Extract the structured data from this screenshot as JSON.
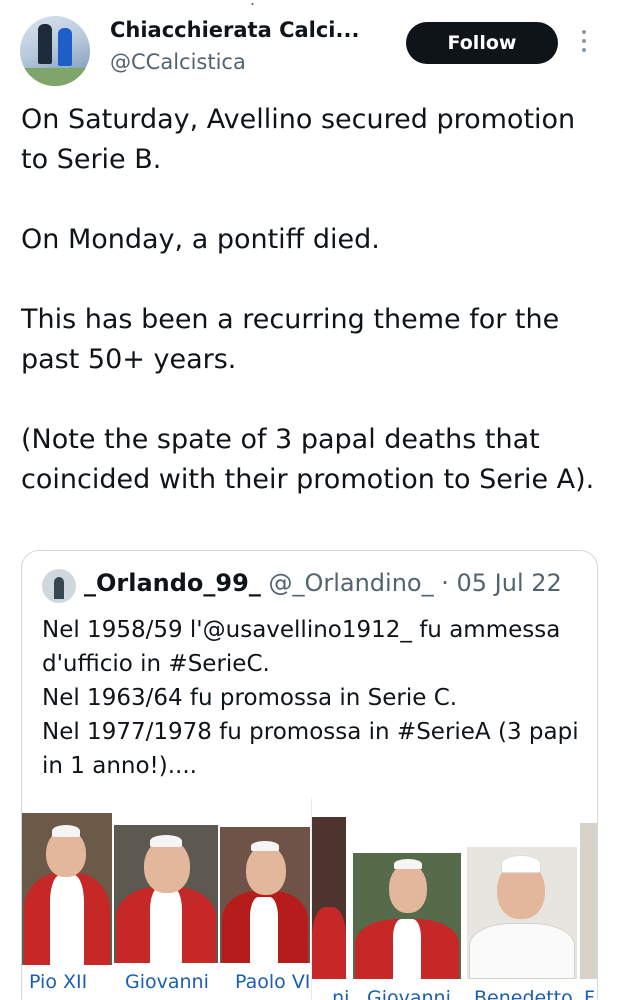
{
  "author": {
    "display_name": "Chiacchierata Calci...",
    "handle": "@CCalcistica",
    "follow_label": "Follow"
  },
  "tweet": {
    "paragraphs": [
      "On Saturday, Avellino secured promotion to Serie B.",
      "On Monday, a pontiff died.",
      "This has been a recurring theme for the past 50+ years.",
      "(Note the spate of 3 papal deaths that coincided with their promotion to Serie A)."
    ]
  },
  "quoted_tweet": {
    "display_name": "_Orlando_99_",
    "handle": "@_Orlandino_",
    "separator": "·",
    "date": "05 Jul 22",
    "lines": [
      "Nel 1958/59 l'@usavellino1912_ fu ammessa d'ufficio in #SerieC.",
      "Nel 1963/64 fu promossa in Serie C.",
      "Nel 1977/1978 fu promossa in #SerieA (3 papi in 1 anno!)...."
    ]
  },
  "gallery": {
    "captions": [
      "Pio XII",
      "Giovanni",
      "Paolo VI",
      "...ni",
      "Giovanni",
      "Benedetto",
      "F..."
    ]
  },
  "colors": {
    "link": "#1a5fb4",
    "muted": "#536471",
    "border": "#cfd9de",
    "button": "#0f1419"
  }
}
